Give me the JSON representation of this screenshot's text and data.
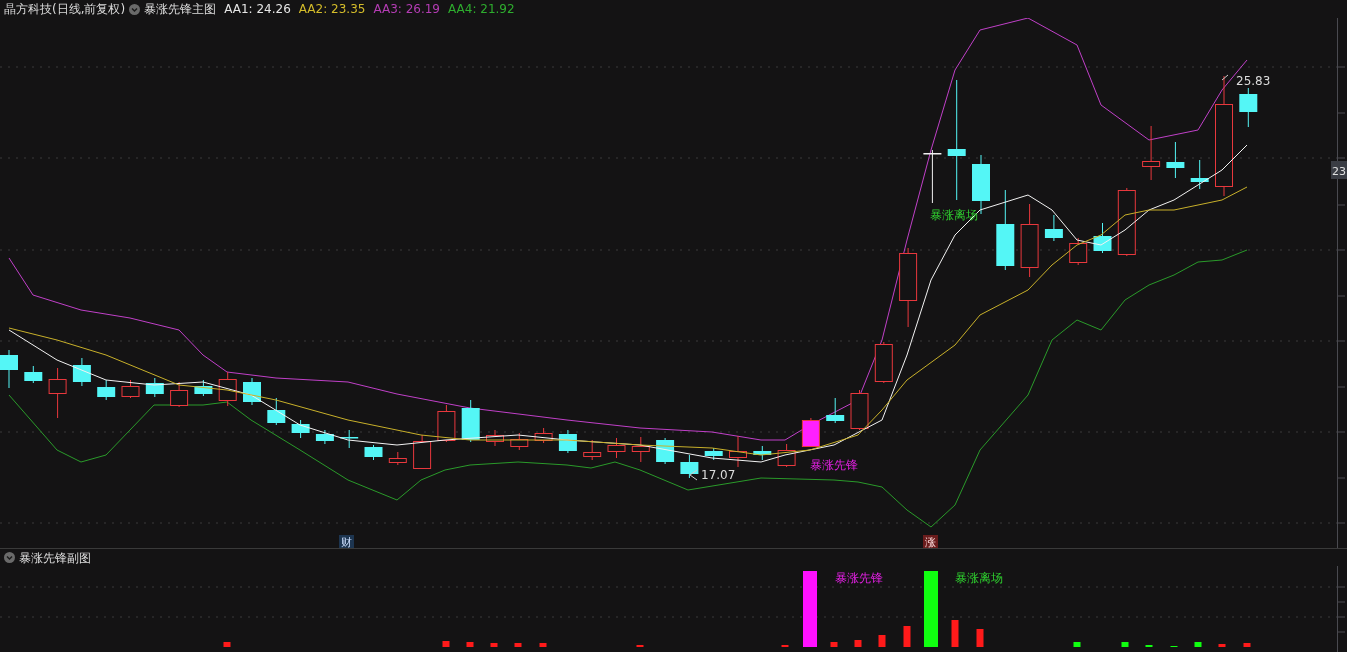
{
  "header": {
    "title": "晶方科技(日线,前复权)",
    "indicator_name": "暴涨先锋主图",
    "values": [
      {
        "label": "AA1: 24.26",
        "color": "#e6e6e6"
      },
      {
        "label": "AA2: 23.35",
        "color": "#d4bc2a"
      },
      {
        "label": "AA3: 26.19",
        "color": "#b43cb4"
      },
      {
        "label": "AA4: 21.92",
        "color": "#2ead2e"
      }
    ]
  },
  "main_chart": {
    "axis_label": "23",
    "low_price": "17.07",
    "high_price": "25.83",
    "signals": [
      {
        "text": "暴涨先锋",
        "kind": "entry"
      },
      {
        "text": "暴涨离场",
        "kind": "exit"
      }
    ],
    "event_tags": [
      {
        "text": "财",
        "kind": "finance"
      },
      {
        "text": "涨",
        "kind": "limit"
      }
    ]
  },
  "sub_panel": {
    "title": "暴涨先锋副图",
    "signals": [
      {
        "text": "暴涨先锋",
        "kind": "entry"
      },
      {
        "text": "暴涨离场",
        "kind": "exit"
      }
    ]
  }
}
